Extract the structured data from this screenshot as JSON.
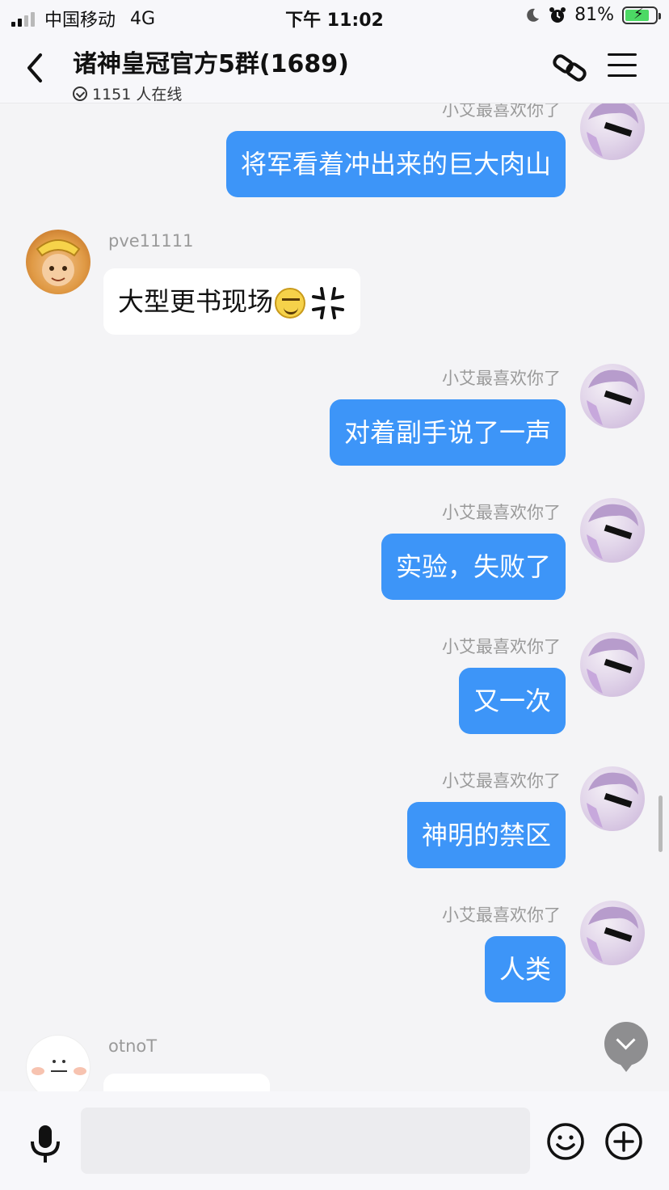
{
  "status_bar": {
    "carrier": "中国移动",
    "network": "4G",
    "time": "下午 11:02",
    "battery": "81%",
    "battery_level": 0.81
  },
  "header": {
    "title": "诸神皇冠官方5群(1689)",
    "online": "1151 人在线"
  },
  "messages": [
    {
      "direction": "out",
      "sender": "小艾最喜欢你了",
      "text": "将军看着冲出来的巨大肉山"
    },
    {
      "direction": "in",
      "sender": "pve11111",
      "text": "大型更书现场"
    },
    {
      "direction": "out",
      "sender": "小艾最喜欢你了",
      "text": "对着副手说了一声"
    },
    {
      "direction": "out",
      "sender": "小艾最喜欢你了",
      "text": "实验，失败了"
    },
    {
      "direction": "out",
      "sender": "小艾最喜欢你了",
      "text": "又一次"
    },
    {
      "direction": "out",
      "sender": "小艾最喜欢你了",
      "text": "神明的禁区"
    },
    {
      "direction": "out",
      "sender": "小艾最喜欢你了",
      "text": "人类"
    },
    {
      "direction": "in",
      "sender": "otnoT",
      "text": ""
    }
  ],
  "icons": {
    "back": "chevron-left-icon",
    "link": "link-icon",
    "menu": "menu-icon",
    "mic": "microphone-icon",
    "emoji": "smiley-icon",
    "add": "plus-icon",
    "scroll_down": "chevron-down-icon"
  },
  "colors": {
    "outgoing_bubble": "#3d95f8",
    "incoming_bubble": "#ffffff",
    "background": "#f4f4f6"
  }
}
